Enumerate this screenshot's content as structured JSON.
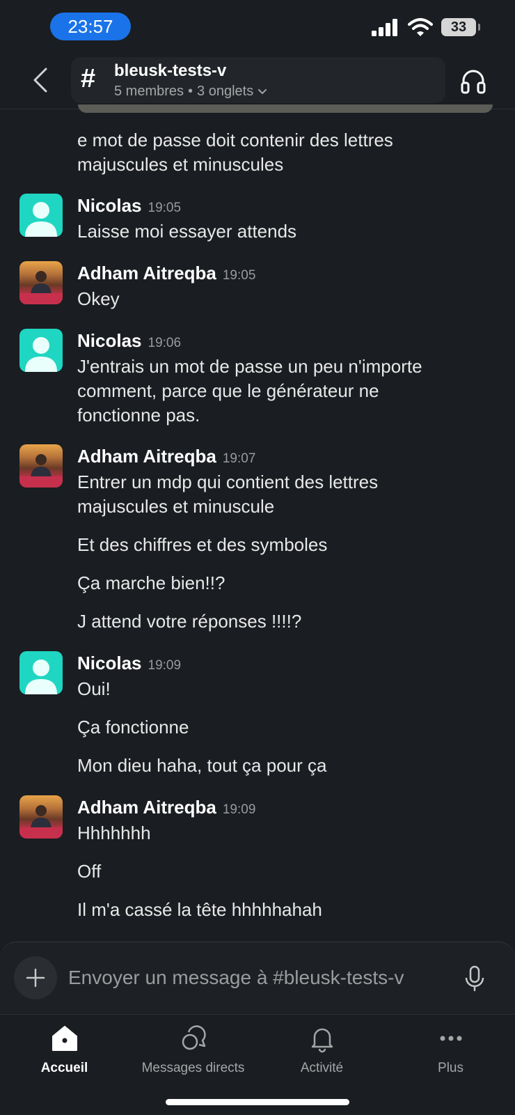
{
  "status": {
    "time": "23:57",
    "battery": "33"
  },
  "header": {
    "channel_name": "bleusk-tests-v",
    "members": "5 membres",
    "tabs": "3 onglets"
  },
  "messages": [
    {
      "continuation": [
        "e mot de passe doit contenir des lettres",
        "majuscules et minuscules"
      ]
    },
    {
      "author": "Nicolas",
      "time": "19:05",
      "lines": [
        "Laisse moi essayer attends"
      ]
    },
    {
      "author": "Adham Aitreqba",
      "time": "19:05",
      "lines": [
        "Okey"
      ]
    },
    {
      "author": "Nicolas",
      "time": "19:06",
      "lines": [
        "J'entrais un mot de passe un peu n'importe",
        "comment, parce que le générateur ne",
        "fonctionne pas."
      ]
    },
    {
      "author": "Adham Aitreqba",
      "time": "19:07",
      "lines": [
        "Entrer un mdp qui contient des lettres",
        "majuscules et minuscule"
      ],
      "extra": [
        "Et des chiffres et des symboles",
        "Ça marche bien!!?",
        "J attend votre réponses !!!!?"
      ]
    },
    {
      "author": "Nicolas",
      "time": "19:09",
      "lines": [
        "Oui!"
      ],
      "extra": [
        "Ça fonctionne",
        "Mon dieu haha, tout ça pour ça"
      ]
    },
    {
      "author": "Adham Aitreqba",
      "time": "19:09",
      "lines": [
        "Hhhhhhh"
      ],
      "extra": [
        "Off",
        "Il m'a cassé la tête hhhhhahah"
      ]
    }
  ],
  "composer": {
    "placeholder": "Envoyer un message à #bleusk-tests-v"
  },
  "tabbar": {
    "home": "Accueil",
    "dms": "Messages directs",
    "activity": "Activité",
    "more": "Plus"
  }
}
